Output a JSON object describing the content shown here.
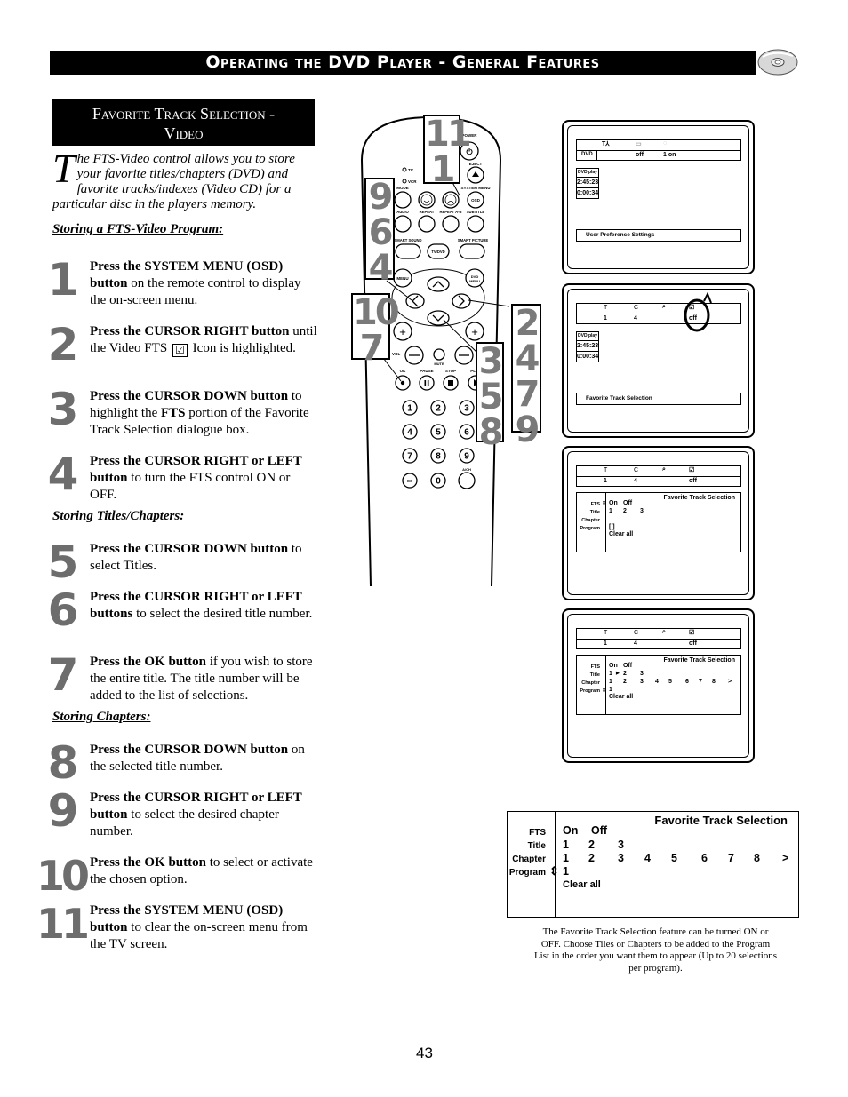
{
  "header": {
    "title": "Operating the DVD Player - General Features",
    "icon": "disc-icon"
  },
  "section": {
    "title_line1": "Favorite Track Selection -",
    "title_line2": "Video"
  },
  "intro": {
    "dropcap": "T",
    "text": "he FTS-Video control allows you to store your favorite titles/chapters (DVD) and favorite tracks/indexes (Video CD) for a particular disc in the players memory."
  },
  "subheads": {
    "storing_program": "Storing a FTS-Video Program",
    "storing_titles": "Storing Titles/Chapters",
    "storing_chapters": "Storing Chapters",
    "colon": ":"
  },
  "steps": [
    {
      "num": "1",
      "bold": "Press the SYSTEM MENU (OSD) button",
      "rest": " on the remote control to display the on-screen menu."
    },
    {
      "num": "2",
      "bold": "Press the CURSOR RIGHT button",
      "rest_a": " until the Video FTS ",
      "icon": "☑",
      "rest_b": " Icon is highlighted."
    },
    {
      "num": "3",
      "bold": "Press the CURSOR DOWN button",
      "rest_a": " to highlight the ",
      "bold2": "FTS",
      "rest_b": " portion of the Favorite Track Selection dialogue box."
    },
    {
      "num": "4",
      "bold": "Press the CURSOR RIGHT or LEFT button",
      "rest": " to turn the FTS control ON or OFF."
    },
    {
      "num": "5",
      "bold": "Press the CURSOR DOWN button",
      "rest": " to select Titles."
    },
    {
      "num": "6",
      "bold": "Press the CURSOR RIGHT or LEFT buttons",
      "rest": " to select the desired title number."
    },
    {
      "num": "7",
      "bold": "Press the OK button",
      "rest": " if you wish to store the entire title. The title number will be added to the list of selections."
    },
    {
      "num": "8",
      "bold": "Press the CURSOR DOWN button",
      "rest": " on the selected title number."
    },
    {
      "num": "9",
      "bold": "Press the CURSOR RIGHT or LEFT button",
      "rest": " to select the desired chapter number."
    },
    {
      "num": "10",
      "bold": "Press the OK button",
      "rest": " to select or activate the chosen option."
    },
    {
      "num": "11",
      "bold": "Press the SYSTEM MENU (OSD) button",
      "rest": " to clear the on-screen menu from the TV screen."
    }
  ],
  "remote": {
    "labels": {
      "power": "POWER",
      "eject": "EJECT",
      "tv": "TV",
      "vcr": "VCR",
      "mode": "MODE",
      "system_menu": "SYSTEM MENU",
      "osd": "OSD",
      "audio": "AUDIO",
      "repeat": "REPEAT",
      "repeat_ab": "REPEAT A-B",
      "subtitle": "SUBTITLE",
      "smart_sound": "SMART SOUND",
      "tv_dvd": "TV/DVD",
      "smart_picture": "SMART PICTURE",
      "menu": "MENU",
      "dvd_menu": "DVD MENU",
      "vol": "VOL",
      "mute": "MUTE",
      "ok": "OK",
      "pause": "PAUSE",
      "stop": "STOP",
      "play": "PLAY",
      "ach": "A/CH",
      "cc": "CC"
    },
    "digits": [
      "1",
      "2",
      "3",
      "4",
      "5",
      "6",
      "7",
      "8",
      "9",
      "0"
    ],
    "callouts": {
      "osd": [
        "11",
        "1"
      ],
      "left": [
        "9",
        "6",
        "4"
      ],
      "ok": [
        "10",
        "7"
      ],
      "down": [
        "3",
        "5",
        "8"
      ],
      "right": [
        "2",
        "4",
        "7",
        "9"
      ]
    }
  },
  "screens": [
    {
      "bar_top": [
        "",
        "off",
        "1 on"
      ],
      "time": {
        "disc": "DVD",
        "state": "play",
        "t1": "2:45:23",
        "t2": "0:00:34"
      },
      "info": "User Preference Settings"
    },
    {
      "bar_top": [
        "T",
        "C",
        "",
        ""
      ],
      "bar_bottom": [
        "1",
        "4",
        "",
        "off"
      ],
      "time": {
        "disc": "DVD",
        "state": "play",
        "t1": "2:45:23",
        "t2": "0:00:34"
      },
      "info": "Favorite Track Selection"
    },
    {
      "bar_top": [
        "T",
        "C",
        "",
        ""
      ],
      "bar_bottom": [
        "1",
        "4",
        "",
        "off"
      ],
      "panel": {
        "header": "Favorite Track Selection",
        "labels": [
          "FTS",
          "Title",
          "Chapter",
          "Program"
        ],
        "fts": [
          "On",
          "Off"
        ],
        "titles": [
          "1",
          "2",
          "3"
        ],
        "program": "[ ]",
        "clear": "Clear all"
      }
    },
    {
      "bar_top": [
        "T",
        "C",
        "",
        ""
      ],
      "bar_bottom": [
        "1",
        "4",
        "",
        "off"
      ],
      "panel": {
        "header": "Favorite Track Selection",
        "labels": [
          "FTS",
          "Title",
          "Chapter",
          "Program"
        ],
        "fts": [
          "On",
          "Off"
        ],
        "titles": [
          "1",
          "2",
          "3"
        ],
        "chapters": [
          "1",
          "2",
          "3",
          "4",
          "5",
          "6",
          "7",
          "8",
          ">"
        ],
        "program": "1",
        "clear": "Clear all"
      }
    }
  ],
  "big_panel": {
    "header": "Favorite Track Selection",
    "labels": [
      "FTS",
      "Title",
      "Chapter",
      "Program"
    ],
    "fts": [
      "On",
      "Off"
    ],
    "titles": [
      "1",
      "2",
      "3"
    ],
    "chapters": [
      "1",
      "2",
      "3",
      "4",
      "5",
      "6",
      "7",
      "8",
      ">"
    ],
    "program": "1",
    "clear": "Clear all"
  },
  "caption": "The Favorite Track Selection feature can be turned ON or OFF. Choose Tiles or Chapters to be added to the Program List in the order you want them to appear (Up to 20 selections per program).",
  "page_number": "43"
}
